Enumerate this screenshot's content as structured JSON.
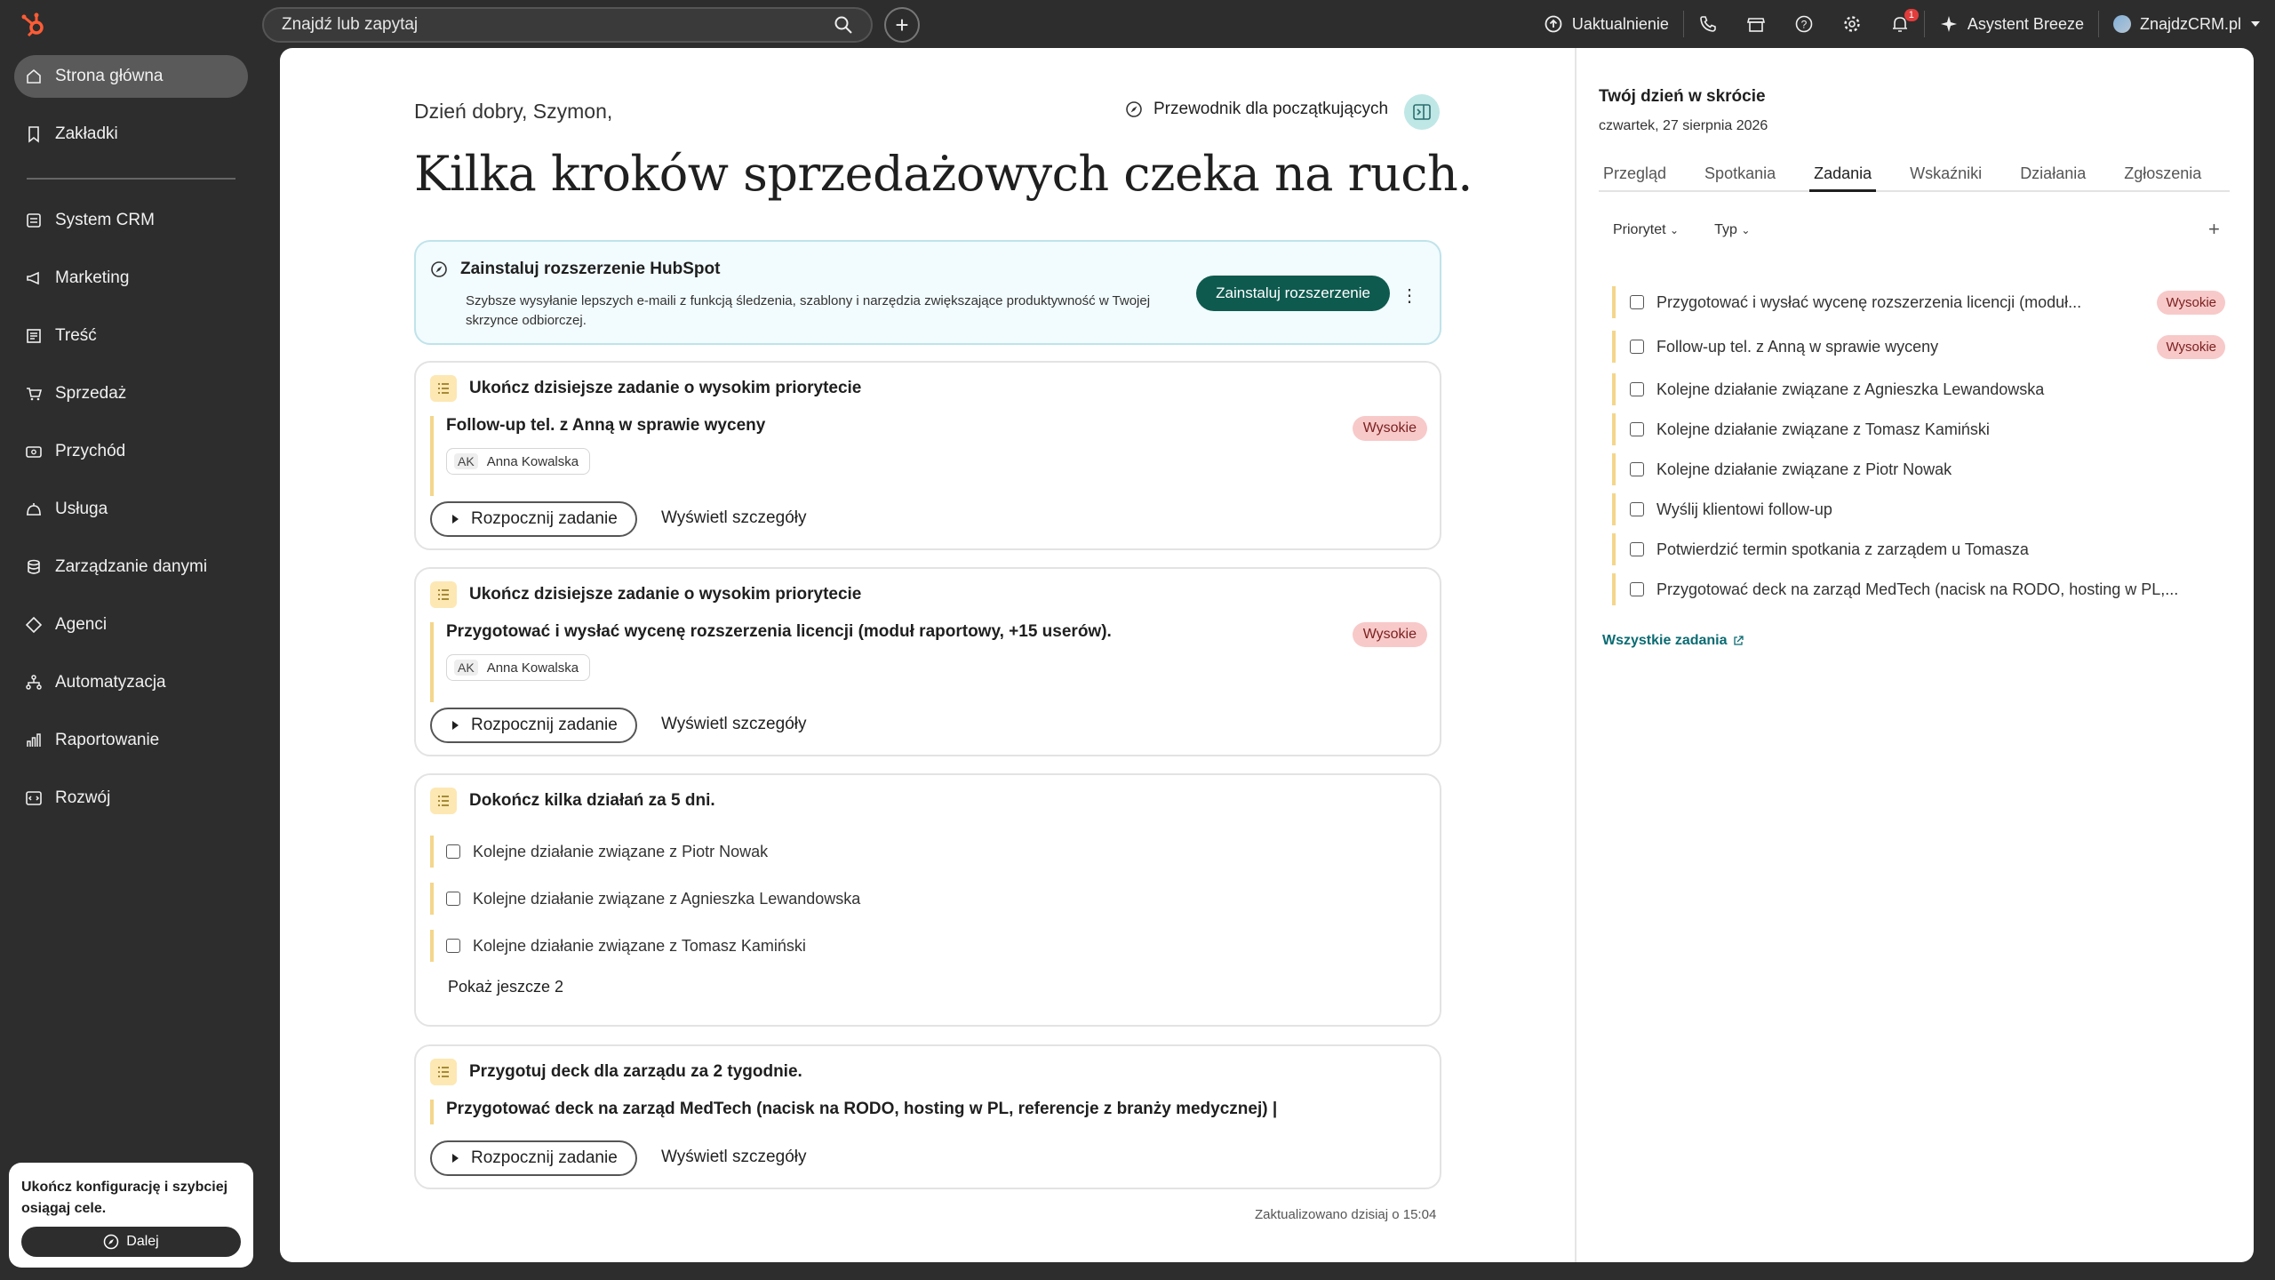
{
  "colors": {
    "brand": "#ff5c35",
    "accent": "#0e5a4f",
    "high": "#f8c9c9"
  },
  "topbar": {
    "search_placeholder": "Znajdź lub zapytaj",
    "upgrade": "Uaktualnienie",
    "notifications_count": "1",
    "breeze": "Asystent Breeze",
    "account": "ZnajdzCRM.pl"
  },
  "sidebar": {
    "items": [
      {
        "label": "Strona główna",
        "icon": "home-icon"
      },
      {
        "label": "Zakładki",
        "icon": "bookmark-icon"
      },
      {
        "label": "System CRM",
        "icon": "crm-icon"
      },
      {
        "label": "Marketing",
        "icon": "megaphone-icon"
      },
      {
        "label": "Treść",
        "icon": "content-icon"
      },
      {
        "label": "Sprzedaż",
        "icon": "sales-icon"
      },
      {
        "label": "Przychód",
        "icon": "revenue-icon"
      },
      {
        "label": "Usługa",
        "icon": "service-icon"
      },
      {
        "label": "Zarządzanie danymi",
        "icon": "database-icon"
      },
      {
        "label": "Agenci",
        "icon": "agents-icon"
      },
      {
        "label": "Automatyzacja",
        "icon": "automation-icon"
      },
      {
        "label": "Raportowanie",
        "icon": "reporting-icon"
      },
      {
        "label": "Rozwój",
        "icon": "development-icon"
      }
    ],
    "setup": {
      "text": "Ukończ konfigurację i szybciej osiągaj cele.",
      "button": "Dalej"
    }
  },
  "main": {
    "greeting": "Dzień dobry, Szymon,",
    "guide": "Przewodnik dla początkujących",
    "headline": "Kilka kroków sprzedażowych czeka na ruch.",
    "extension": {
      "title": "Zainstaluj rozszerzenie HubSpot",
      "desc": "Szybsze wysyłanie lepszych e-maili z funkcją śledzenia, szablony i narzędzia zwiększające produktywność w Twojej skrzynce odbiorczej.",
      "button": "Zainstaluj rozszerzenie"
    },
    "card1": {
      "head": "Ukończ dzisiejsze zadanie o wysokim priorytecie",
      "title": "Follow-up tel. z Anną w sprawie wyceny",
      "priority": "Wysokie",
      "contact_initials": "AK",
      "contact": "Anna Kowalska",
      "start": "Rozpocznij zadanie",
      "details": "Wyświetl szczegóły"
    },
    "card2": {
      "head": "Ukończ dzisiejsze zadanie o wysokim priorytecie",
      "title": "Przygotować i wysłać wycenę rozszerzenia licencji (moduł raportowy, +15 userów).",
      "priority": "Wysokie",
      "contact_initials": "AK",
      "contact": "Anna Kowalska",
      "start": "Rozpocznij zadanie",
      "details": "Wyświetl szczegóły"
    },
    "card3": {
      "head": "Dokończ kilka działań za 5 dni.",
      "items": [
        "Kolejne działanie związane z Piotr Nowak",
        "Kolejne działanie związane z Agnieszka Lewandowska",
        "Kolejne działanie związane z Tomasz Kamiński"
      ],
      "more": "Pokaż jeszcze 2"
    },
    "card4": {
      "head": "Przygotuj deck dla zarządu za 2 tygodnie.",
      "title": "Przygotować deck na zarząd MedTech (nacisk na RODO, hosting w PL, referencje z branży medycznej) |",
      "start": "Rozpocznij zadanie",
      "details": "Wyświetl szczegóły"
    },
    "updated": "Zaktualizowano dzisiaj o 15:04"
  },
  "right": {
    "title": "Twój dzień w skrócie",
    "date": "czwartek, 27 sierpnia 2026",
    "tabs": [
      "Przegląd",
      "Spotkania",
      "Zadania",
      "Wskaźniki",
      "Działania",
      "Zgłoszenia"
    ],
    "filters": [
      "Priorytet",
      "Typ"
    ],
    "tasks": [
      {
        "text": "Przygotować i wysłać wycenę rozszerzenia licencji (moduł...",
        "priority": "Wysokie"
      },
      {
        "text": "Follow-up tel. z Anną w sprawie wyceny",
        "priority": "Wysokie"
      },
      {
        "text": "Kolejne działanie związane z Agnieszka Lewandowska",
        "priority": ""
      },
      {
        "text": "Kolejne działanie związane z Tomasz Kamiński",
        "priority": ""
      },
      {
        "text": "Kolejne działanie związane z Piotr Nowak",
        "priority": ""
      },
      {
        "text": "Wyślij klientowi follow-up",
        "priority": ""
      },
      {
        "text": "Potwierdzić termin spotkania z zarządem u Tomasza",
        "priority": ""
      },
      {
        "text": "Przygotować deck na zarząd MedTech (nacisk na RODO, hosting w PL,...",
        "priority": ""
      }
    ],
    "all_tasks": "Wszystkie zadania"
  }
}
